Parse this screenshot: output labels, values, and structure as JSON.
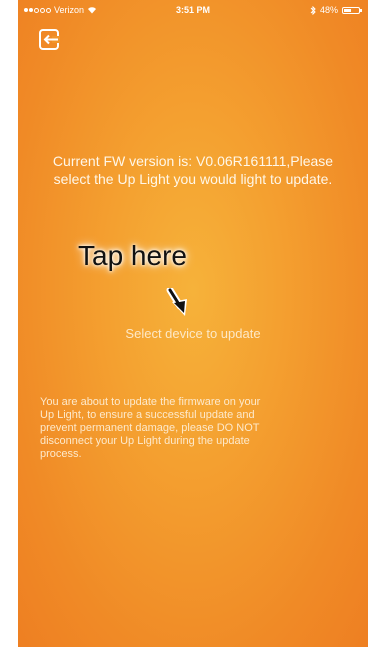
{
  "status_bar": {
    "carrier": "Verizon",
    "time": "3:51 PM",
    "battery_percent": "48%",
    "battery_level": 0.48,
    "signal_bars_filled": 2,
    "signal_bars_total": 5
  },
  "header": {
    "back_icon": "exit-icon"
  },
  "main": {
    "firmware_message": "Current FW version is: V0.06R161111,Please\nselect the Up Light you would light to update.",
    "annotation": "Tap here",
    "select_device_label": "Select device to update",
    "warning": "You are about to update the firmware on your\nUp Light, to ensure a successful update and\nprevent permanent damage, please DO NOT\ndisconnect your Up Light during the update\nprocess."
  },
  "colors": {
    "background_center": "#f6b23a",
    "background_edge": "#ee7f22",
    "text": "#ffffff"
  }
}
